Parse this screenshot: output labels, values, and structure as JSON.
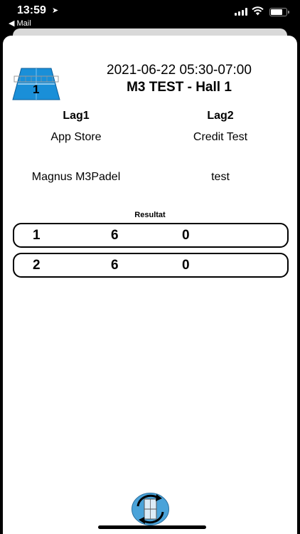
{
  "status_bar": {
    "time": "13:59",
    "back_label": "◀ Mail"
  },
  "match": {
    "court_number": "1",
    "datetime": "2021-06-22 05:30-07:00",
    "hall": "M3 TEST - Hall 1",
    "court_icon": "padel-court-icon"
  },
  "teams": {
    "team1_label": "Lag1",
    "team2_label": "Lag2",
    "team1_players": [
      "App Store",
      "Magnus M3Padel"
    ],
    "team2_players": [
      "Credit Test",
      "test"
    ]
  },
  "result": {
    "label": "Resultat",
    "sets": [
      {
        "set": "1",
        "team1": "6",
        "team2": "0"
      },
      {
        "set": "2",
        "team1": "6",
        "team2": "0"
      }
    ]
  },
  "toolbar": {
    "refresh_icon": "court-refresh-icon"
  },
  "colors": {
    "court_blue": "#1a8fd8",
    "button_blue": "#4aa3d9"
  }
}
